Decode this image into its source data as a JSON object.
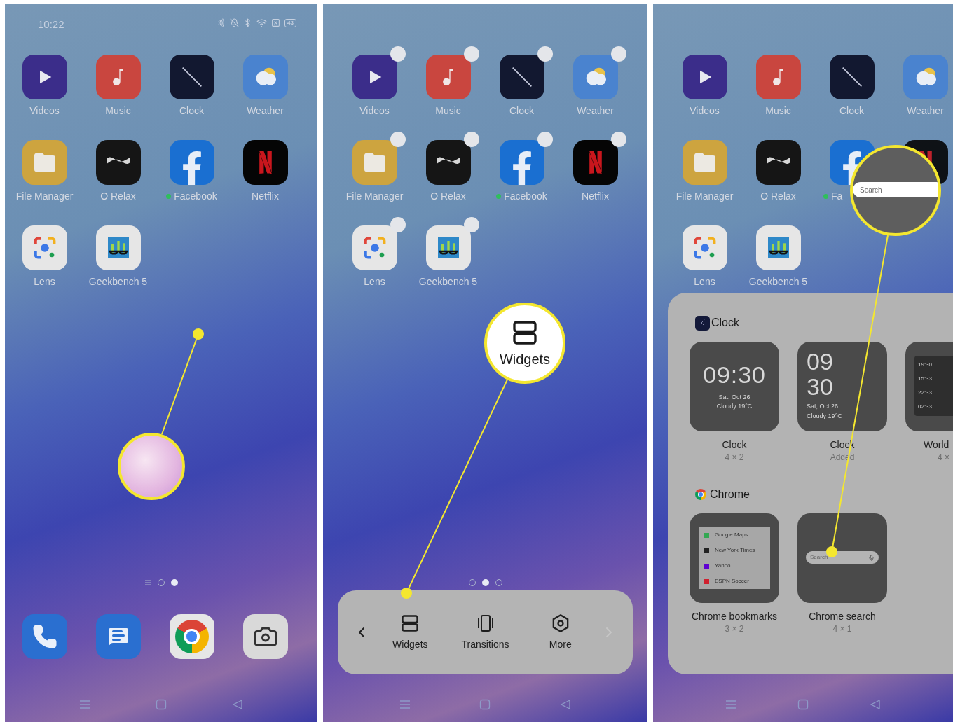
{
  "panels": [
    {
      "status_bar": {
        "time": "10:22",
        "battery": "43"
      },
      "apps": [
        {
          "label": "Videos"
        },
        {
          "label": "Music"
        },
        {
          "label": "Clock"
        },
        {
          "label": "Weather"
        },
        {
          "label": "File Manager"
        },
        {
          "label": "O Relax"
        },
        {
          "label": "Facebook",
          "notification": true
        },
        {
          "label": "Netflix"
        },
        {
          "label": "Lens"
        },
        {
          "label": "Geekbench 5"
        }
      ],
      "page_indicator": [
        {
          "kind": "list",
          "selected": false
        },
        {
          "kind": "dot",
          "selected": false
        },
        {
          "kind": "dot",
          "selected": true
        }
      ],
      "dock": true,
      "callout": {
        "kind": "magnifier"
      }
    },
    {
      "edit_mode": true,
      "apps": [
        {
          "label": "Videos"
        },
        {
          "label": "Music"
        },
        {
          "label": "Clock"
        },
        {
          "label": "Weather"
        },
        {
          "label": "File Manager"
        },
        {
          "label": "O Relax"
        },
        {
          "label": "Facebook",
          "notification": true
        },
        {
          "label": "Netflix"
        },
        {
          "label": "Lens"
        },
        {
          "label": "Geekbench 5"
        }
      ],
      "page_indicator": [
        {
          "kind": "dot",
          "selected": false
        },
        {
          "kind": "dot",
          "selected": true
        },
        {
          "kind": "dot",
          "selected": false
        }
      ],
      "menu": {
        "items": [
          {
            "label": "Widgets"
          },
          {
            "label": "Transitions"
          },
          {
            "label": "More"
          }
        ],
        "next_disabled": true
      },
      "callout": {
        "kind": "label",
        "label": "Widgets"
      }
    },
    {
      "apps": [
        {
          "label": "Videos"
        },
        {
          "label": "Music"
        },
        {
          "label": "Clock"
        },
        {
          "label": "Weather"
        },
        {
          "label": "File Manager"
        },
        {
          "label": "O Relax"
        },
        {
          "label": "Fa",
          "notification": true,
          "covered": true
        },
        {
          "covered": true
        },
        {
          "label": "Lens"
        },
        {
          "label": "Geekbench 5"
        }
      ],
      "widget_sheet": {
        "sections": [
          {
            "app": "Clock",
            "widgets": [
              {
                "kind": "clock_wide",
                "time": "09:30",
                "date": "Sat, Oct 26",
                "weather": "Cloudy 19°C",
                "name": "Clock",
                "size": "4 × 2"
              },
              {
                "kind": "clock_stacked",
                "hours": "09",
                "minutes": "30",
                "date": "Sat, Oct 26",
                "weather": "Cloudy 19°C",
                "name": "Clock",
                "size": "Added"
              },
              {
                "kind": "world",
                "entries": [
                  "19:30",
                  "15:33",
                  "22:33",
                  "02:33"
                ],
                "name": "World",
                "size": "4 ×"
              }
            ]
          },
          {
            "app": "Chrome",
            "widgets": [
              {
                "kind": "bookmarks",
                "bookmarks": [
                  "Google Maps",
                  "New York Times",
                  "Yahoo",
                  "ESPN Soccer"
                ],
                "name": "Chrome bookmarks",
                "size": "3 × 2"
              },
              {
                "kind": "search",
                "placeholder": "Search",
                "name": "Chrome search",
                "size": "4 × 1"
              }
            ]
          }
        ]
      },
      "callout": {
        "kind": "zoom",
        "placeholder": "Search"
      }
    }
  ]
}
